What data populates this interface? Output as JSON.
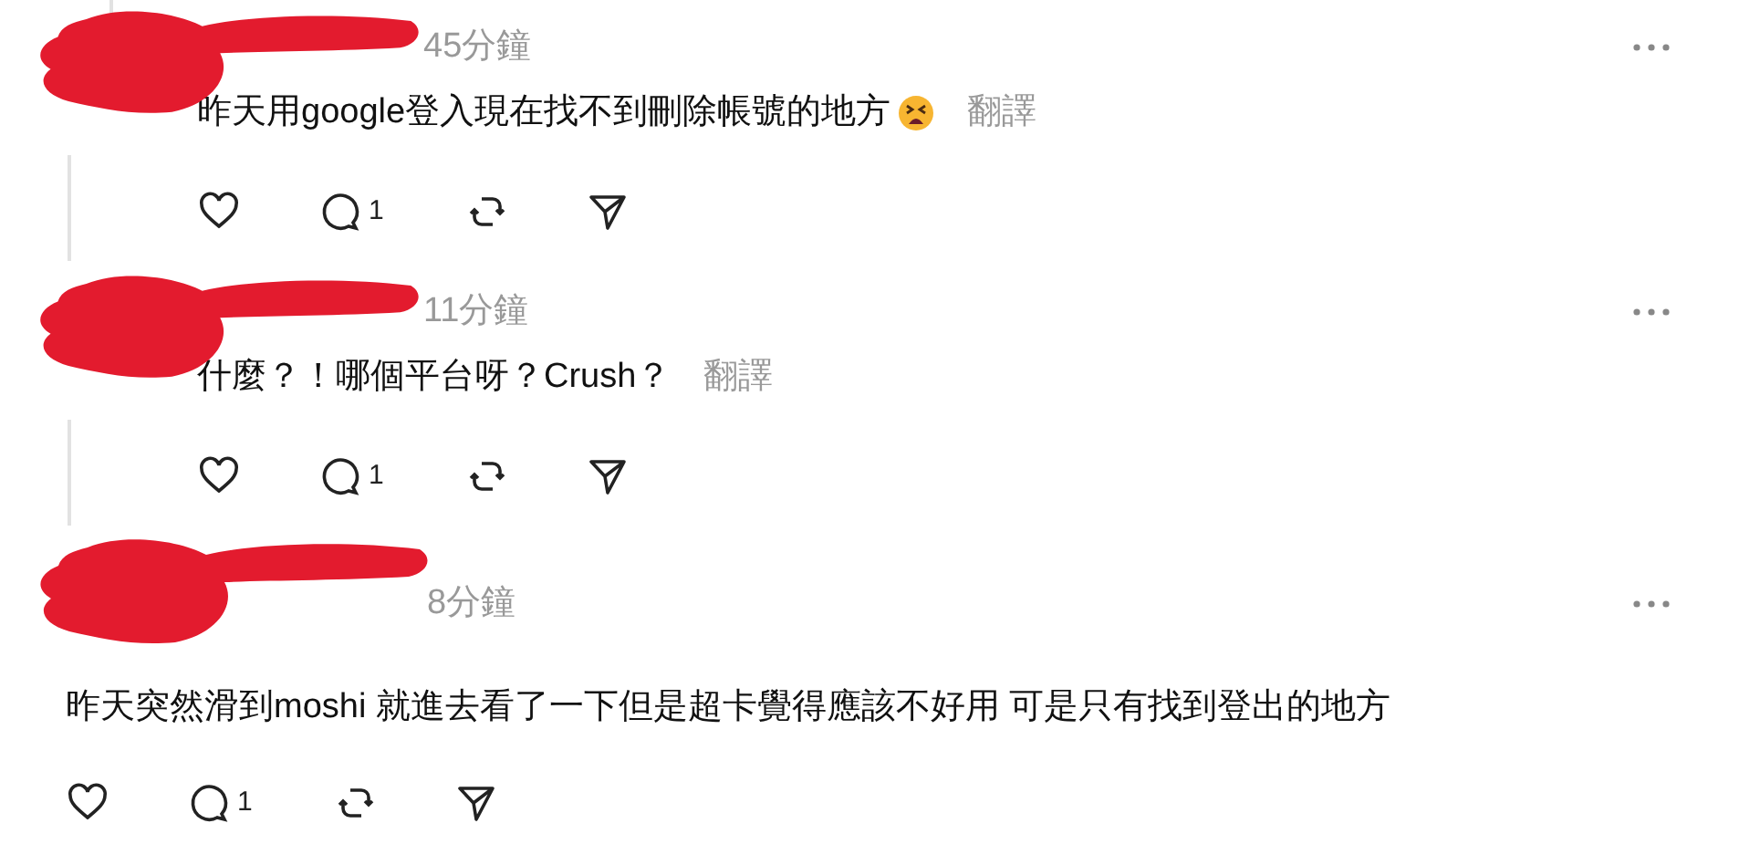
{
  "comments": [
    {
      "kind": "reply",
      "time": "45分鐘",
      "text": "昨天用google登入現在找不到刪除帳號的地方",
      "emoji": true,
      "translate": "翻譯",
      "reply_count": "1"
    },
    {
      "kind": "reply",
      "time": "11分鐘",
      "text": "什麼？！哪個平台呀？Crush？",
      "emoji": false,
      "translate": "翻譯",
      "reply_count": "1"
    },
    {
      "kind": "post",
      "time": "8分鐘",
      "text": "昨天突然滑到moshi 就進去看了一下但是超卡覺得應該不好用 可是只有找到登出的地方",
      "emoji": false,
      "reply_count": "1"
    }
  ]
}
